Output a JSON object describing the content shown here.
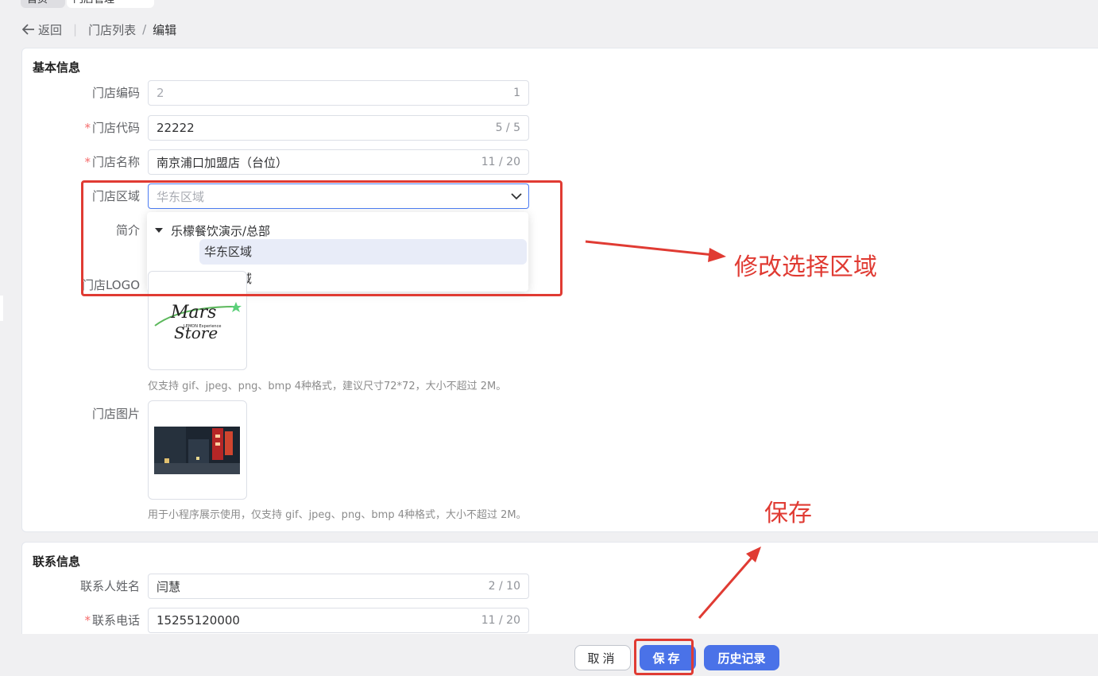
{
  "tabs": [
    "首页",
    "门店管理"
  ],
  "breadcrumb": {
    "back_label": "返回",
    "parent": "门店列表",
    "separator": "/",
    "current": "编辑"
  },
  "basic_info": {
    "title": "基本信息",
    "store_number": {
      "label": "门店编码",
      "value": "2",
      "count": "1"
    },
    "store_code": {
      "label": "门店代码",
      "required": "*",
      "value": "22222",
      "count": "5 / 5"
    },
    "store_name": {
      "label": "门店名称",
      "required": "*",
      "value": "南京浦口加盟店（台位）",
      "count": "11 / 20"
    },
    "store_region": {
      "label": "门店区域",
      "placeholder": "华东区域"
    },
    "region_tree": {
      "parent": "乐檬餐饮演示/总部",
      "children": [
        {
          "label": "华东区域",
          "selected": true
        },
        {
          "label": "华中区域",
          "selected": false
        }
      ]
    },
    "intro": {
      "label": "简介"
    },
    "logo": {
      "label": "门店LOGO",
      "image_text": "Mars",
      "image_text2": "Store",
      "image_subtext": "LEMON Experience",
      "hint": "仅支持 gif、jpeg、png、bmp 4种格式，建议尺寸72*72，大小不超过 2M。"
    },
    "photo": {
      "label": "门店图片",
      "hint": "用于小程序展示使用，仅支持 gif、jpeg、png、bmp 4种格式，大小不超过 2M。"
    }
  },
  "contact_info": {
    "title": "联系信息",
    "contact_name": {
      "label": "联系人姓名",
      "value": "闫慧",
      "count": "2 / 10"
    },
    "contact_phone": {
      "label": "联系电话",
      "required": "*",
      "value": "15255120000",
      "count": "11 / 20"
    }
  },
  "footer": {
    "cancel_label": "取消",
    "save_label": "保存",
    "history_label": "历史记录"
  },
  "annotations": {
    "region_note": "修改选择区域",
    "save_note": "保存",
    "color": "#e03b33"
  },
  "colors": {
    "primary": "#4a72e8",
    "required": "#f56c6c",
    "annotation": "#e03b33"
  }
}
